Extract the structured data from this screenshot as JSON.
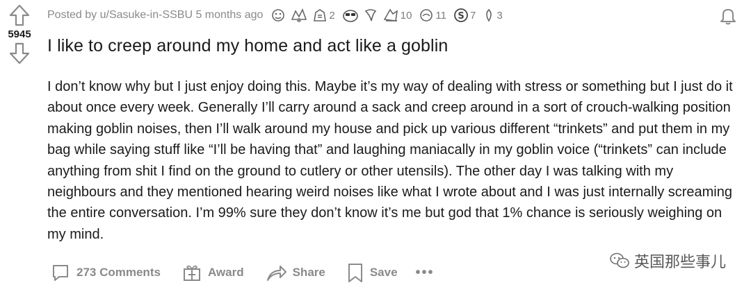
{
  "vote": {
    "score": "5945"
  },
  "post": {
    "posted_by": "Posted by u/Sasuke-in-SSBU 5 months ago",
    "title": "I like to creep around my home and act like a goblin",
    "body": "I don’t know why but I just enjoy doing this. Maybe it’s my way of dealing with stress or something but I just do it about once every week. Generally I’ll carry around a sack and creep around in a sort of crouch-walking position making goblin noises, then I’ll walk around my house and pick up various different “trinkets” and put them in my bag while saying stuff like “I’ll be having that” and laughing maniacally in my goblin voice (“trinkets” can include anything from shit I find on the ground to cutlery or other utensils). The other day I was talking with my neighbours and they mentioned hearing weird noises like what I wrote about and I was just internally screaming the entire conversation. I’m 99% sure they don’t know it’s me but god that 1% chance is seriously weighing on my mind."
  },
  "awards": [
    {
      "icon": "award-1-icon",
      "count": ""
    },
    {
      "icon": "award-2-icon",
      "count": ""
    },
    {
      "icon": "award-3-icon",
      "count": "2"
    },
    {
      "icon": "award-4-icon",
      "count": ""
    },
    {
      "icon": "award-5-icon",
      "count": ""
    },
    {
      "icon": "award-6-icon",
      "count": "10"
    },
    {
      "icon": "award-7-icon",
      "count": "11"
    },
    {
      "icon": "award-8-icon",
      "count": "7"
    },
    {
      "icon": "award-9-icon",
      "count": "3"
    }
  ],
  "actions": {
    "comments": "273 Comments",
    "award": "Award",
    "share": "Share",
    "save": "Save",
    "more": "•••"
  },
  "watermark": {
    "text": "英国那些事儿"
  },
  "colors": {
    "meta": "#878a8c",
    "text": "#1a1a1b"
  }
}
